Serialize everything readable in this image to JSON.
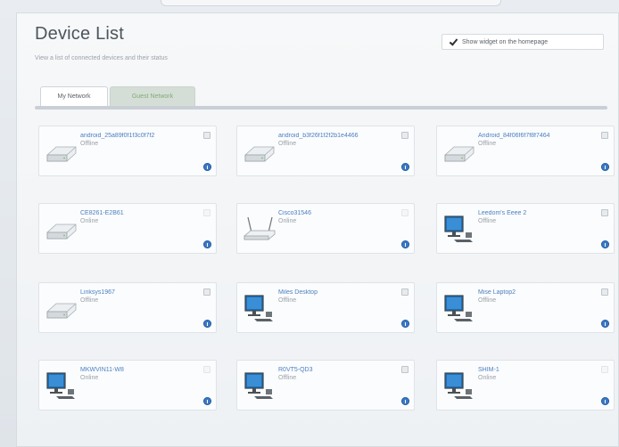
{
  "page": {
    "title": "Device List",
    "subtitle": "View a list of connected devices and their status",
    "show_widget_label": "Show widget on the homepage"
  },
  "tabs": [
    {
      "label": "My Network",
      "active": true
    },
    {
      "label": "Guest Network",
      "active": false
    }
  ],
  "colors": {
    "accent": "#4c7fc2",
    "guest_tab_text": "#7fae76",
    "info_dot": "#3a78c4"
  },
  "devices": [
    {
      "name": "android_25a89f0f1f3c0f7f2",
      "status": "Offline",
      "icon": "storage-drive-icon"
    },
    {
      "name": "android_b3f26f1f2f2b1e4466",
      "status": "Offline",
      "icon": "storage-drive-icon"
    },
    {
      "name": "Android_84f06f6f7f8f7464",
      "status": "Offline",
      "icon": "storage-drive-icon"
    },
    {
      "name": "CE8261-E2B61",
      "status": "Online",
      "icon": "storage-drive-icon"
    },
    {
      "name": "Cisco31546",
      "status": "Online",
      "icon": "router-icon"
    },
    {
      "name": "Leedom's Eeee 2",
      "status": "Offline",
      "icon": "desktop-computer-icon"
    },
    {
      "name": "Linksys1967",
      "status": "Offline",
      "icon": "storage-drive-icon"
    },
    {
      "name": "Miles Desktop",
      "status": "Offline",
      "icon": "desktop-computer-icon"
    },
    {
      "name": "Mise Laptop2",
      "status": "Offline",
      "icon": "desktop-computer-icon"
    },
    {
      "name": "MKWVIN11-W8",
      "status": "Online",
      "icon": "desktop-computer-icon"
    },
    {
      "name": "R0VT5-QD3",
      "status": "Offline",
      "icon": "desktop-computer-icon"
    },
    {
      "name": "SHIM-1",
      "status": "Online",
      "icon": "desktop-computer-icon"
    }
  ]
}
